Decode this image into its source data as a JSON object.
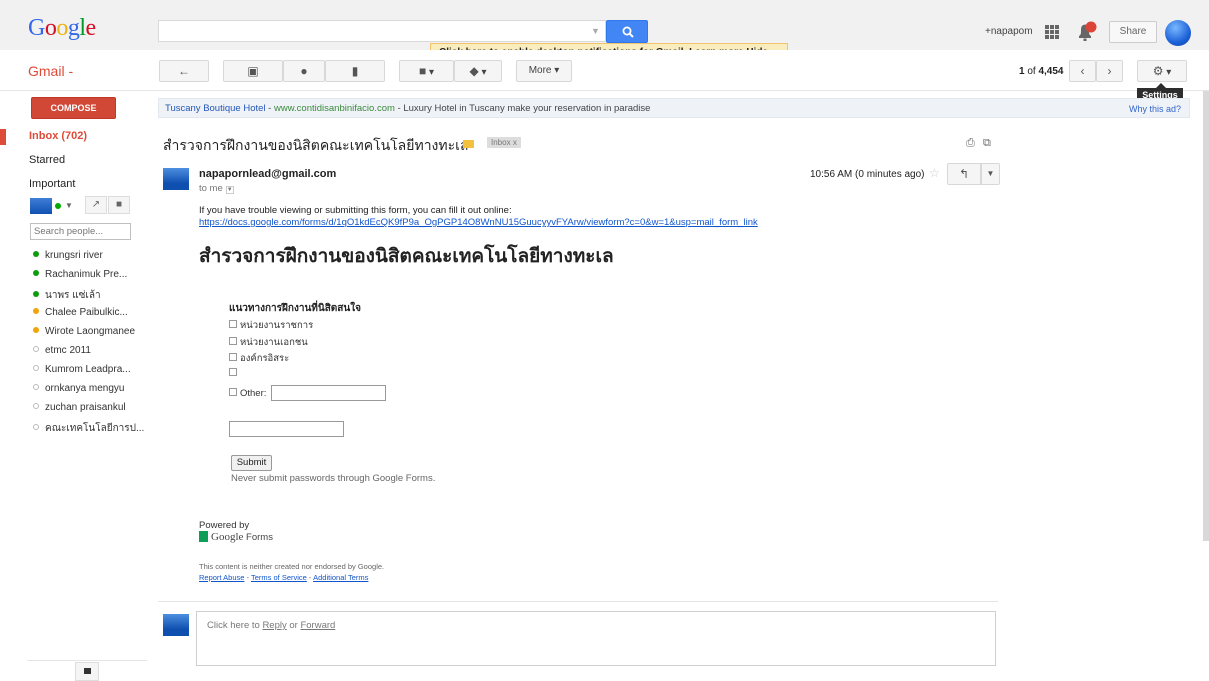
{
  "header": {
    "logo_letters": [
      "G",
      "o",
      "o",
      "g",
      "l",
      "e"
    ],
    "search_value": "",
    "notification": {
      "part1": "Click here to enable",
      "part2": "desktop notifications for Gmail.",
      "learn_more": "Learn more",
      "hide": "Hide"
    },
    "user": "+napapom",
    "share": "Share"
  },
  "toolbar": {
    "app_label": "Gmail -",
    "more_label": "More",
    "pager_pos": "1",
    "pager_of": "of",
    "pager_total": "4,454",
    "settings_tooltip": "Settings"
  },
  "nav": {
    "compose": "COMPOSE",
    "items": [
      {
        "label": "Inbox (702)"
      },
      {
        "label": "Starred"
      },
      {
        "label": "Important"
      }
    ],
    "people_search_placeholder": "Search people..."
  },
  "contacts": [
    {
      "name": "krungsri river",
      "status": "online",
      "color": "#0a9f0a"
    },
    {
      "name": "Rachanimuk Pre...",
      "status": "online",
      "color": "#0a9f0a"
    },
    {
      "name": "นาพร แซ่เล้า",
      "status": "online",
      "color": "#0a9f0a"
    },
    {
      "name": "Chalee Paibulkic...",
      "status": "idle",
      "color": "#f0a30a"
    },
    {
      "name": "Wirote Laongmanee",
      "status": "idle",
      "color": "#f0a30a"
    },
    {
      "name": "etmc 2011",
      "status": "offline",
      "color": "#bbbbbb"
    },
    {
      "name": "Kumrom Leadpra...",
      "status": "offline",
      "color": "#bbbbbb"
    },
    {
      "name": "ornkanya mengyu",
      "status": "offline",
      "color": "#bbbbbb"
    },
    {
      "name": "zuchan praisankul",
      "status": "offline",
      "color": "#bbbbbb"
    },
    {
      "name": "คณะเทคโนโลยีการป...",
      "status": "offline",
      "color": "#bbbbbb"
    }
  ],
  "ad": {
    "title": "Tuscany Boutique Hotel",
    "sep": " - ",
    "url": "www.contidisanbinifacio.com",
    "desc": " - Luxury Hotel in Tuscany make your reservation in paradise",
    "why": "Why this ad?"
  },
  "message": {
    "subject": "สำรวจการฝึกงานของนิสิตคณะเทคโนโลยีทางทะเล",
    "label": "Inbox",
    "label_close": "x",
    "sender": "napapornlead@gmail.com",
    "to": "to me",
    "time": "10:56 AM (0 minutes ago)",
    "trouble_text": "If you have trouble viewing or submitting this form, you can fill it out online:",
    "form_link": "https://docs.google.com/forms/d/1qO1kdEcQK9fP9a_OgPGP14O8WnNU15GuucyyvFYArw/viewform?c=0&w=1&usp=mail_form_link"
  },
  "form": {
    "title": "สำรวจการฝึกงานของนิสิตคณะเทคโนโลยีทางทะเล",
    "question": "แนวทางการฝึกงานที่นิสิตสนใจ",
    "options": [
      "หน่วยงานราชการ",
      "หน่วยงานเอกชน",
      "องค์กรอิสระ",
      ""
    ],
    "other_label": "Other:",
    "submit": "Submit",
    "never_note": "Never submit passwords through Google Forms."
  },
  "footer": {
    "powered_by": "Powered by",
    "google_forms_a": "Google",
    "google_forms_b": " Forms",
    "disclaimer": "This content is neither created nor endorsed by Google.",
    "report_abuse": "Report Abuse",
    "sep": " - ",
    "terms": "Terms of Service",
    "additional": "Additional Terms"
  },
  "reply": {
    "prefix": "Click here to ",
    "reply": "Reply",
    "or": " or ",
    "forward": "Forward"
  },
  "colors": {
    "accent_red": "#dd4b39",
    "compose_red": "#d14836",
    "search_blue": "#4285f4",
    "link_blue": "#1155cc",
    "banner_yellow": "#f9edbe"
  }
}
